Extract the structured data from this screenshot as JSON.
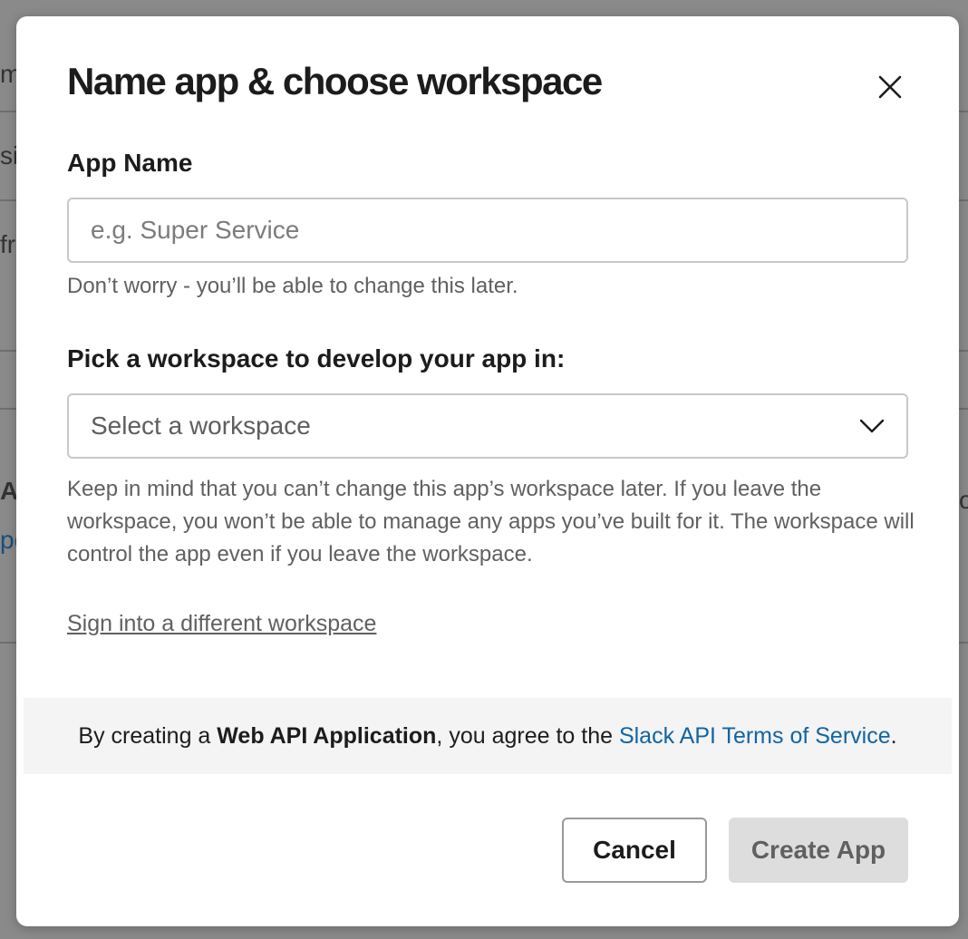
{
  "modal": {
    "title": "Name app & choose workspace",
    "app_name_label": "App Name",
    "app_name_placeholder": "e.g. Super Service",
    "app_name_value": "",
    "app_name_hint": "Don’t worry - you’ll be able to change this later.",
    "workspace_label": "Pick a workspace to develop your app in:",
    "workspace_select_value": "Select a workspace",
    "workspace_hint": "Keep in mind that you can’t change this app’s workspace later. If you leave the workspace, you won’t be able to manage any apps you’ve built for it. The workspace will control the app even if you leave the workspace.",
    "sign_in_link": "Sign into a different workspace",
    "terms": {
      "prefix": "By creating a ",
      "bold": "Web API Application",
      "middle": ", you agree to the ",
      "link": "Slack API Terms of Service",
      "suffix": "."
    },
    "cancel_label": "Cancel",
    "create_label": "Create App"
  },
  "background_fragments": [
    "m",
    "si",
    "fr",
    "Ap",
    "pc",
    "o"
  ],
  "icons": {
    "close": "close-icon",
    "dropdown": "chevron-down-icon"
  },
  "colors": {
    "link": "#1264a3",
    "disabled_button": "#dddddd",
    "terms_bar": "#f4f4f4"
  }
}
